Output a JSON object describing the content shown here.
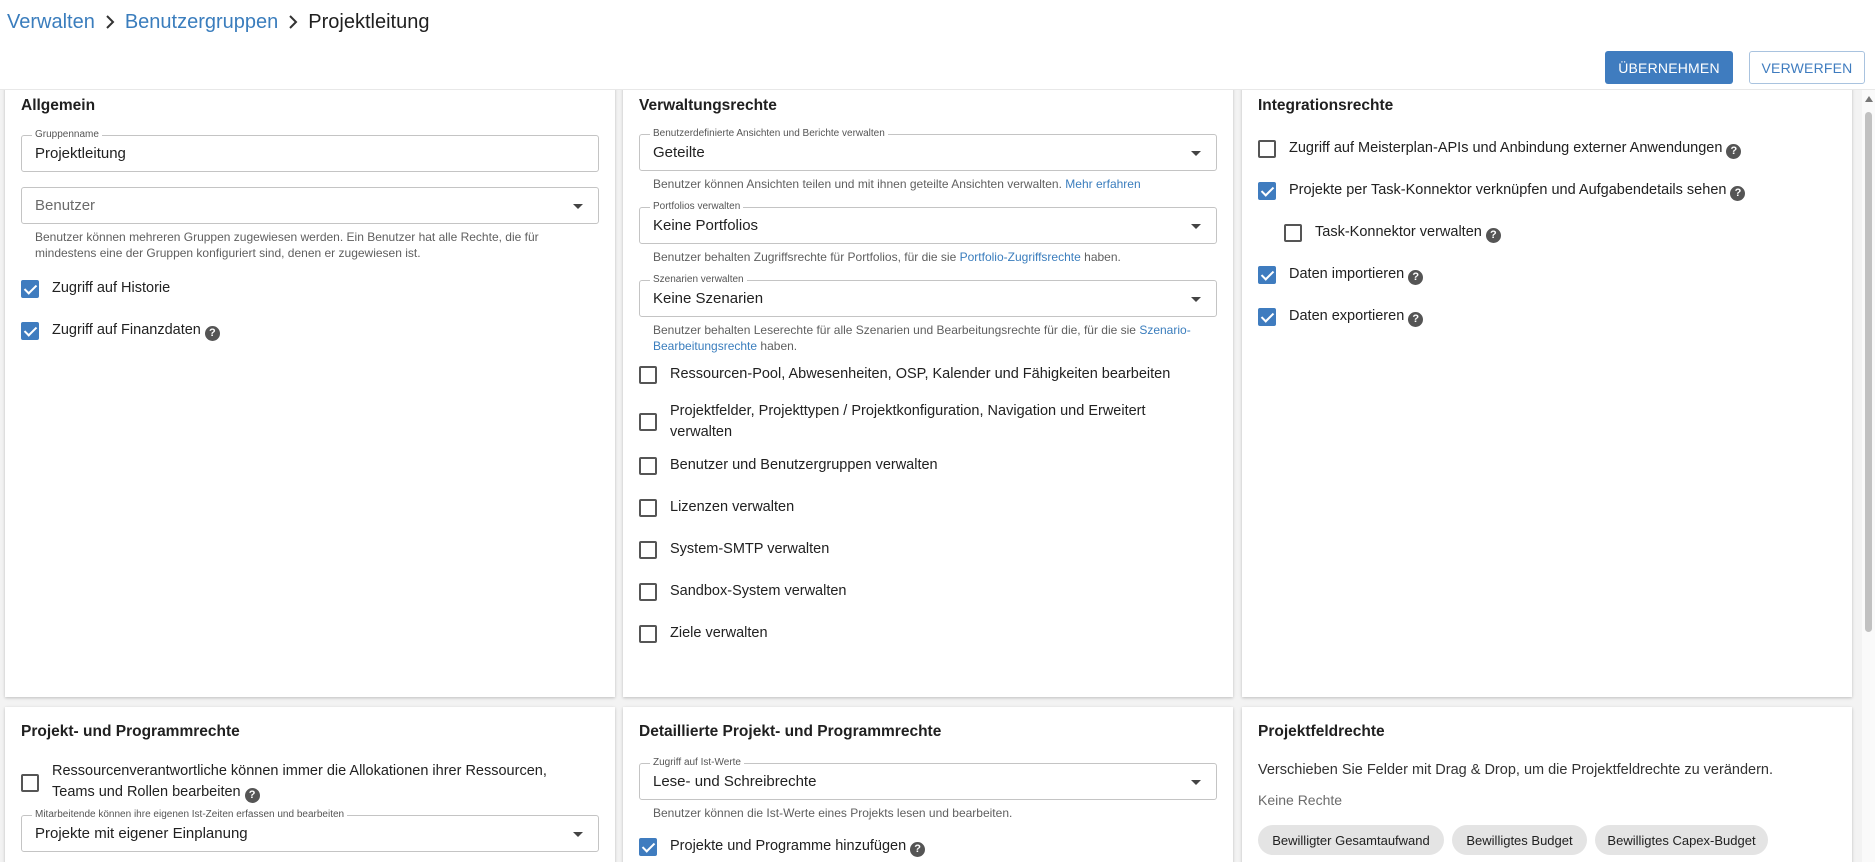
{
  "breadcrumb": {
    "items": [
      "Verwalten",
      "Benutzergruppen"
    ],
    "current": "Projektleitung"
  },
  "toolbar": {
    "apply_label": "ÜBERNEHMEN",
    "discard_label": "VERWERFEN"
  },
  "general": {
    "title": "Allgemein",
    "group_name_label": "Gruppenname",
    "group_name_value": "Projektleitung",
    "users_placeholder": "Benutzer",
    "users_help": "Benutzer können mehreren Gruppen zugewiesen werden. Ein Benutzer hat alle Rechte, die für mindestens eine der Gruppen konfiguriert sind, denen er zugewiesen ist.",
    "history_label": "Zugriff auf Historie",
    "history_checked": true,
    "finance_label": "Zugriff auf Finanzdaten",
    "finance_checked": true
  },
  "admin": {
    "title": "Verwaltungsrechte",
    "views_label": "Benutzerdefinierte Ansichten und Berichte verwalten",
    "views_value": "Geteilte",
    "views_help": "Benutzer können Ansichten teilen und mit ihnen geteilte Ansichten verwalten.",
    "views_help_link": "Mehr erfahren",
    "portfolios_label": "Portfolios verwalten",
    "portfolios_value": "Keine Portfolios",
    "portfolios_help_pre": "Benutzer behalten Zugriffsrechte für Portfolios, für die sie",
    "portfolios_help_link": "Portfolio-Zugriffsrechte",
    "portfolios_help_post": "haben.",
    "scenarios_label": "Szenarien verwalten",
    "scenarios_value": "Keine Szenarien",
    "scenarios_help_pre": "Benutzer behalten Leserechte für alle Szenarien und Bearbeitungsrechte für die, für die sie",
    "scenarios_help_link": "Szenario-Bearbeitungsrechte",
    "scenarios_help_post": "haben.",
    "options": [
      {
        "label": "Ressourcen-Pool, Abwesenheiten, OSP, Kalender und Fähigkeiten bearbeiten",
        "checked": false
      },
      {
        "label": "Projektfelder, Projekttypen / Projektkonfiguration, Navigation und Erweitert verwalten",
        "checked": false
      },
      {
        "label": "Benutzer und Benutzergruppen verwalten",
        "checked": false
      },
      {
        "label": "Lizenzen verwalten",
        "checked": false
      },
      {
        "label": "System-SMTP verwalten",
        "checked": false
      },
      {
        "label": "Sandbox-System verwalten",
        "checked": false
      },
      {
        "label": "Ziele verwalten",
        "checked": false
      }
    ]
  },
  "integration": {
    "title": "Integrationsrechte",
    "options": [
      {
        "label": "Zugriff auf Meisterplan-APIs und Anbindung externer Anwendungen",
        "checked": false
      },
      {
        "label": "Projekte per Task-Konnektor verknüpfen und Aufgabendetails sehen",
        "checked": true
      },
      {
        "label": "Task-Konnektor verwalten",
        "checked": false
      },
      {
        "label": "Daten importieren",
        "checked": true
      },
      {
        "label": "Daten exportieren",
        "checked": true
      }
    ]
  },
  "project": {
    "title": "Projekt- und Programmrechte",
    "resource_mgr_label": "Ressourcenverantwortliche können immer die Allokationen ihrer Ressourcen, Teams und Rollen bearbeiten",
    "resource_mgr_checked": false,
    "actuals_label": "Mitarbeitende können ihre eigenen Ist-Zeiten erfassen und bearbeiten",
    "actuals_value": "Projekte mit eigener Einplanung"
  },
  "detailed": {
    "title": "Detaillierte Projekt- und Programmrechte",
    "actuals_label": "Zugriff auf Ist-Werte",
    "actuals_value": "Lese- und Schreibrechte",
    "actuals_help": "Benutzer können die Ist-Werte eines Projekts lesen und bearbeiten.",
    "add_label": "Projekte und Programme hinzufügen",
    "add_checked": true
  },
  "fields": {
    "title": "Projektfeldrechte",
    "description": "Verschieben Sie Felder mit Drag & Drop, um die Projektfeldrechte zu verändern.",
    "no_rights_label": "Keine Rechte",
    "chips": [
      "Bewilligter Gesamtaufwand",
      "Bewilligtes Budget",
      "Bewilligtes Capex-Budget"
    ]
  },
  "colors": {
    "accent": "#3f7cbf",
    "link": "#3a7dbd",
    "background": "#f3f3f3"
  }
}
